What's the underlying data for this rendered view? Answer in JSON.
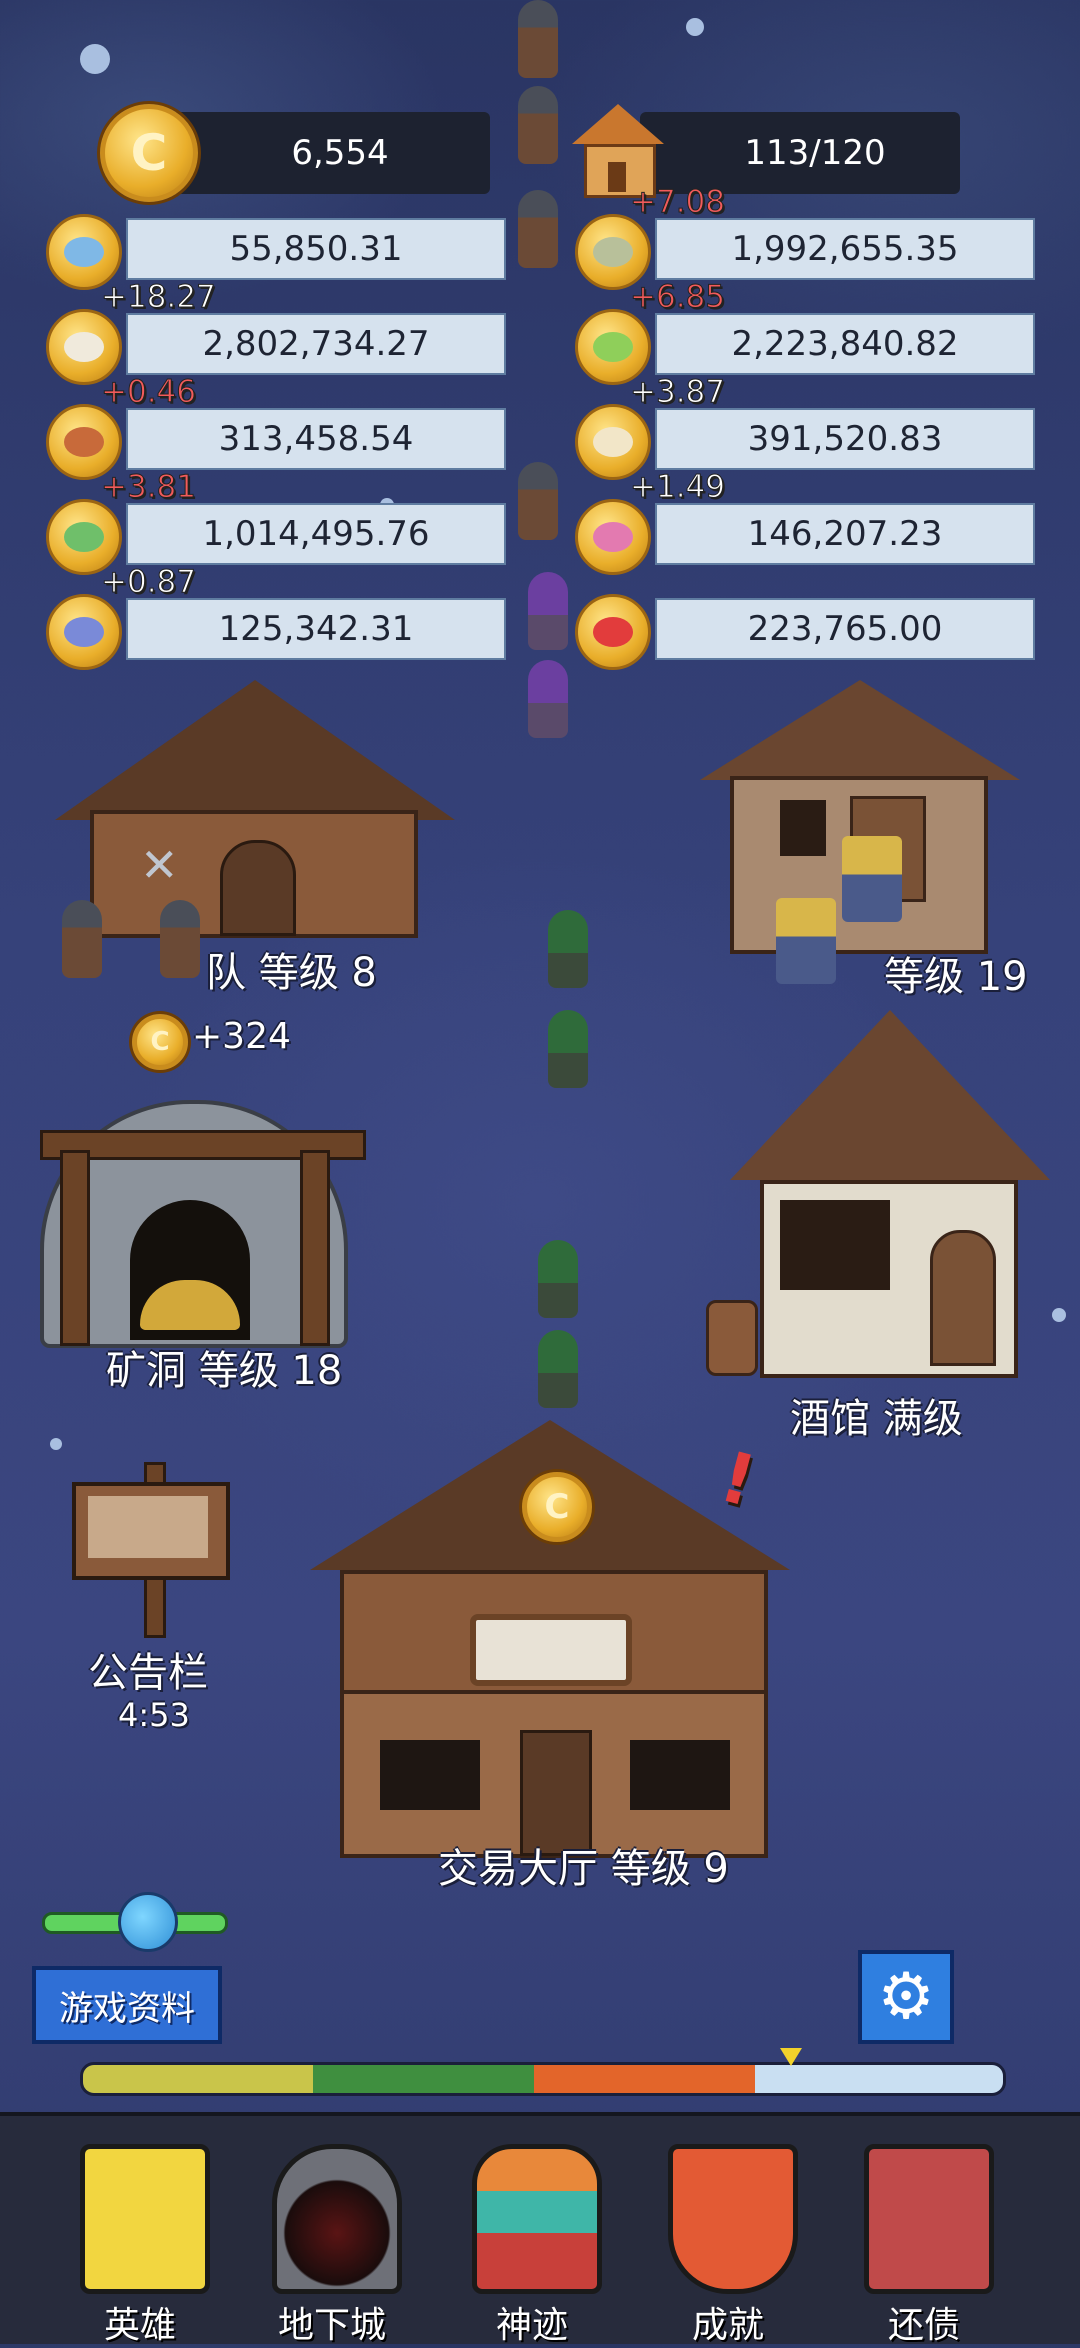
{
  "top": {
    "gold": "6,554",
    "population": "113/120"
  },
  "resources": [
    {
      "icon": "slime-icon",
      "value": "55,850.31",
      "delta": "",
      "delta_color": "",
      "side": "left"
    },
    {
      "icon": "zombie-icon",
      "value": "1,992,655.35",
      "delta": "+7.08",
      "delta_color": "red",
      "side": "right"
    },
    {
      "icon": "skull-icon",
      "value": "2,802,734.27",
      "delta": "+18.27",
      "delta_color": "white",
      "side": "left"
    },
    {
      "icon": "goblin-icon",
      "value": "2,223,840.82",
      "delta": "+6.85",
      "delta_color": "red",
      "side": "right"
    },
    {
      "icon": "treant-icon",
      "value": "313,458.54",
      "delta": "+0.46",
      "delta_color": "red",
      "side": "left"
    },
    {
      "icon": "wolf-icon",
      "value": "391,520.83",
      "delta": "+3.87",
      "delta_color": "white",
      "side": "right"
    },
    {
      "icon": "orc-icon",
      "value": "1,014,495.76",
      "delta": "+3.81",
      "delta_color": "red",
      "side": "left"
    },
    {
      "icon": "mushroom-icon",
      "value": "146,207.23",
      "delta": "+1.49",
      "delta_color": "white",
      "side": "right"
    },
    {
      "icon": "bat-icon",
      "value": "125,342.31",
      "delta": "+0.87",
      "delta_color": "white",
      "side": "left"
    },
    {
      "icon": "demon-icon",
      "value": "223,765.00",
      "delta": "",
      "delta_color": "",
      "side": "right"
    }
  ],
  "buildings": {
    "workshop_label": "队 等级 8",
    "barracks_label": "等级 19",
    "gold_gain": "+324",
    "mine_label": "矿洞 等级 18",
    "tavern_label": "酒馆 满级",
    "trade_hall_label": "交易大厅 等级 9",
    "board_label": "公告栏",
    "board_timer": "4:53"
  },
  "controls": {
    "game_info_label": "游戏资料"
  },
  "nav": [
    {
      "label": "英雄",
      "icon": "tower-icon"
    },
    {
      "label": "地下城",
      "icon": "dungeon-icon"
    },
    {
      "label": "神迹",
      "icon": "totem-icon"
    },
    {
      "label": "成就",
      "icon": "banner-icon"
    },
    {
      "label": "还债",
      "icon": "ledger-icon"
    }
  ],
  "colors": {
    "background": "#36427a",
    "navbar": "#272b3c",
    "delta_red": "#f25b5b",
    "button_blue": "#2f6fd6"
  }
}
